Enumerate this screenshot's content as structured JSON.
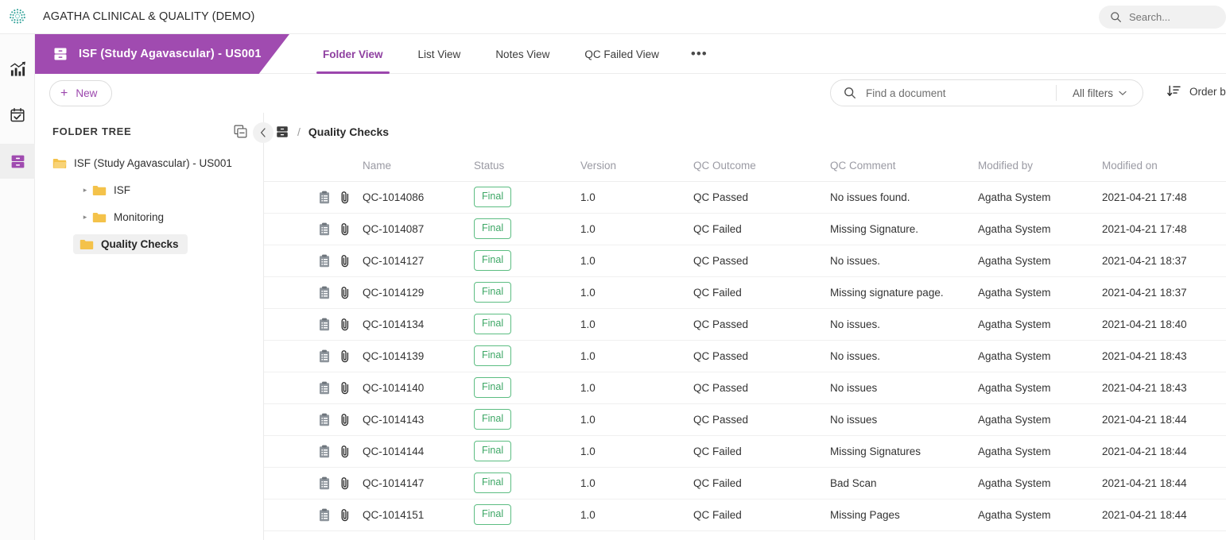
{
  "topbar": {
    "logo_icon": "agatha-dots-logo",
    "app_title": "AGATHA CLINICAL & QUALITY (DEMO)",
    "search_icon": "search-icon",
    "search_placeholder": "Search..."
  },
  "rail": {
    "items": [
      {
        "icon": "analytics-chart-icon",
        "active": false
      },
      {
        "icon": "calendar-check-icon",
        "active": false
      },
      {
        "icon": "file-cabinet-icon",
        "active": true
      }
    ]
  },
  "study": {
    "banner_icon": "file-cabinet-icon",
    "banner_label": "ISF (Study Agavascular) - US001",
    "banner_color": "#a04bb0"
  },
  "tabs": [
    {
      "label": "Folder View",
      "active": true
    },
    {
      "label": "List View",
      "active": false
    },
    {
      "label": "Notes View",
      "active": false
    },
    {
      "label": "QC Failed View",
      "active": false
    },
    {
      "label": "•••",
      "active": false,
      "name": "more-tabs"
    }
  ],
  "toolbar": {
    "new_label": "New",
    "new_icon": "plus-icon",
    "find_icon": "search-icon",
    "find_placeholder": "Find a document",
    "find_value": "",
    "filters_label": "All filters",
    "filters_caret": "chevron-down-icon",
    "order_icon": "sort-descending-icon",
    "order_label": "Order b"
  },
  "folder_tree": {
    "title": "FOLDER TREE",
    "collapse_all_icon": "collapse-all-icon",
    "panel_toggle_icon": "chevron-left-icon",
    "nodes": [
      {
        "label": "ISF (Study Agavascular) - US001",
        "level": 0,
        "icon": "folder-open-icon",
        "caret": "",
        "selected": false
      },
      {
        "label": "ISF",
        "level": 1,
        "icon": "folder-icon",
        "caret": "▸",
        "selected": false
      },
      {
        "label": "Monitoring",
        "level": 1,
        "icon": "folder-icon",
        "caret": "▸",
        "selected": false
      },
      {
        "label": "Quality Checks",
        "level": 1,
        "icon": "folder-icon",
        "caret": "",
        "selected": true
      }
    ]
  },
  "breadcrumb": {
    "root_icon": "file-cabinet-icon",
    "separator": "/",
    "current": "Quality Checks"
  },
  "table": {
    "columns": [
      "",
      "Name",
      "Status",
      "Version",
      "QC Outcome",
      "QC Comment",
      "Modified by",
      "Modified on"
    ],
    "row_icons": [
      "document-icon",
      "paperclip-icon"
    ],
    "rows": [
      {
        "name": "QC-1014086",
        "status": "Final",
        "version": "1.0",
        "outcome": "QC Passed",
        "comment": "No issues found.",
        "modified_by": "Agatha System",
        "modified_on": "2021-04-21 17:48"
      },
      {
        "name": "QC-1014087",
        "status": "Final",
        "version": "1.0",
        "outcome": "QC Failed",
        "comment": "Missing Signature.",
        "modified_by": "Agatha System",
        "modified_on": "2021-04-21 17:48"
      },
      {
        "name": "QC-1014127",
        "status": "Final",
        "version": "1.0",
        "outcome": "QC Passed",
        "comment": "No issues.",
        "modified_by": "Agatha System",
        "modified_on": "2021-04-21 18:37"
      },
      {
        "name": "QC-1014129",
        "status": "Final",
        "version": "1.0",
        "outcome": "QC Failed",
        "comment": "Missing signature page.",
        "modified_by": "Agatha System",
        "modified_on": "2021-04-21 18:37"
      },
      {
        "name": "QC-1014134",
        "status": "Final",
        "version": "1.0",
        "outcome": "QC Passed",
        "comment": "No issues.",
        "modified_by": "Agatha System",
        "modified_on": "2021-04-21 18:40"
      },
      {
        "name": "QC-1014139",
        "status": "Final",
        "version": "1.0",
        "outcome": "QC Passed",
        "comment": "No issues.",
        "modified_by": "Agatha System",
        "modified_on": "2021-04-21 18:43"
      },
      {
        "name": "QC-1014140",
        "status": "Final",
        "version": "1.0",
        "outcome": "QC Passed",
        "comment": "No issues",
        "modified_by": "Agatha System",
        "modified_on": "2021-04-21 18:43"
      },
      {
        "name": "QC-1014143",
        "status": "Final",
        "version": "1.0",
        "outcome": "QC Passed",
        "comment": "No issues",
        "modified_by": "Agatha System",
        "modified_on": "2021-04-21 18:44"
      },
      {
        "name": "QC-1014144",
        "status": "Final",
        "version": "1.0",
        "outcome": "QC Failed",
        "comment": "Missing Signatures",
        "modified_by": "Agatha System",
        "modified_on": "2021-04-21 18:44"
      },
      {
        "name": "QC-1014147",
        "status": "Final",
        "version": "1.0",
        "outcome": "QC Failed",
        "comment": "Bad Scan",
        "modified_by": "Agatha System",
        "modified_on": "2021-04-21 18:44"
      },
      {
        "name": "QC-1014151",
        "status": "Final",
        "version": "1.0",
        "outcome": "QC Failed",
        "comment": "Missing Pages",
        "modified_by": "Agatha System",
        "modified_on": "2021-04-21 18:44"
      }
    ]
  },
  "colors": {
    "accent_purple": "#9b46ad",
    "banner_purple": "#a04bb0",
    "status_green": "#3da765",
    "folder_yellow": "#f5c243",
    "logo_teal": "#2a9d8f"
  }
}
